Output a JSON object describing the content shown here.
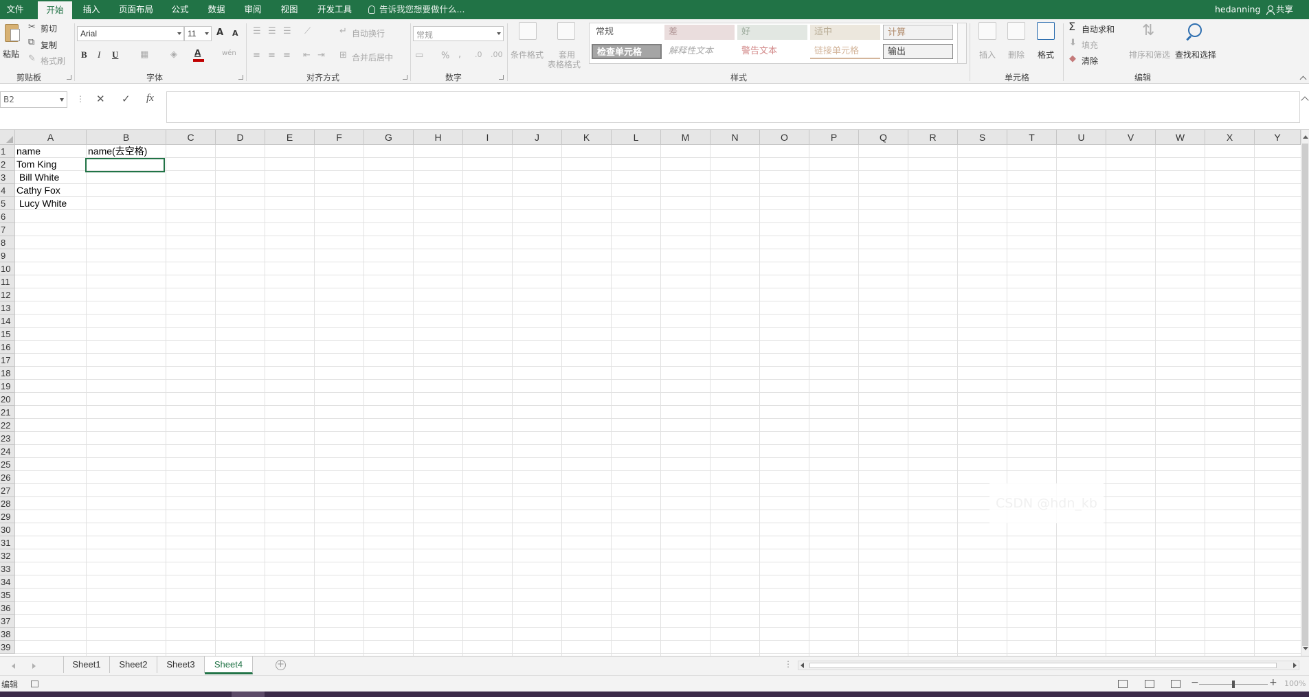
{
  "tabs": [
    "文件",
    "开始",
    "插入",
    "页面布局",
    "公式",
    "数据",
    "审阅",
    "视图",
    "开发工具"
  ],
  "active_tab": "开始",
  "tell_me": "告诉我您想要做什么...",
  "user": "hedanning",
  "share": "共享",
  "ribbon": {
    "clipboard": {
      "paste": "粘贴",
      "cut": "剪切",
      "copy": "复制",
      "format_painter": "格式刷",
      "label": "剪贴板"
    },
    "font": {
      "name": "Arial",
      "size": "11",
      "bold": "B",
      "italic": "I",
      "underline": "U",
      "grow": "A",
      "shrink": "A",
      "font_color": "A",
      "wen": "wén",
      "label": "字体"
    },
    "alignment": {
      "wrap": "自动换行",
      "merge": "合并后居中",
      "label": "对齐方式"
    },
    "number": {
      "format": "常规",
      "percent": "%",
      "comma": ",",
      "label": "数字"
    },
    "styles": {
      "conditional": "条件格式",
      "table_format_1": "套用",
      "table_format_2": "表格格式",
      "cells": [
        "常规",
        "差",
        "好",
        "适中",
        "计算",
        "检查单元格",
        "解释性文本",
        "警告文本",
        "链接单元格",
        "输出"
      ],
      "label": "样式"
    },
    "cells": {
      "insert": "插入",
      "delete": "删除",
      "format": "格式",
      "label": "单元格"
    },
    "editing": {
      "autosum": "自动求和",
      "fill": "填充",
      "clear": "清除",
      "sort": "排序和筛选",
      "find": "查找和选择",
      "label": "编辑"
    }
  },
  "formula_bar": {
    "name_box": "B2",
    "cancel": "✕",
    "enter": "✓",
    "fx": "fx",
    "content": ""
  },
  "columns": [
    "A",
    "B",
    "C",
    "D",
    "E",
    "F",
    "G",
    "H",
    "I",
    "J",
    "K",
    "L",
    "M",
    "N",
    "O",
    "P",
    "Q",
    "R",
    "S",
    "T",
    "U",
    "V",
    "W",
    "X",
    "Y"
  ],
  "row_count": 39,
  "cells": {
    "A1": "name",
    "B1": "name(去空格)",
    "A2": "Tom King",
    "A3": " Bill White",
    "A4": "Cathy Fox",
    "A5": " Lucy White"
  },
  "watermark": "CSDN @hdn_kb",
  "sheets": [
    "Sheet1",
    "Sheet2",
    "Sheet3",
    "Sheet4"
  ],
  "active_sheet": "Sheet4",
  "status": {
    "mode": "编辑",
    "zoom": "100%"
  },
  "colors": {
    "accent": "#217346",
    "ribbon_bg": "#f3f3f3",
    "header_bg": "#e6e6e6",
    "grid_line": "#e1e1e1"
  }
}
